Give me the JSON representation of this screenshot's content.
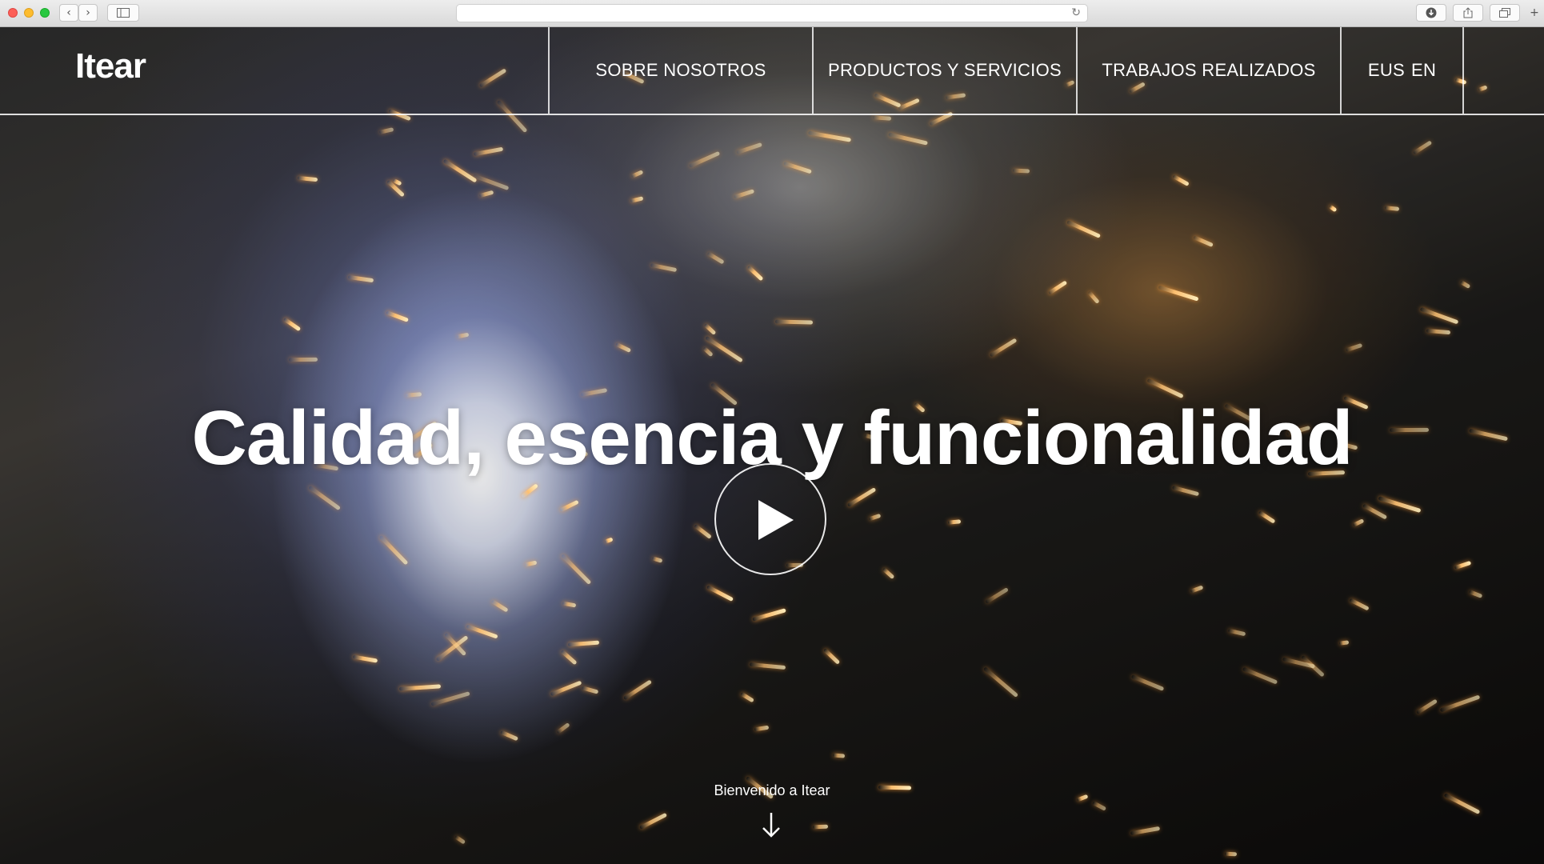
{
  "browser": {
    "back_icon": "chevron-left-icon",
    "forward_icon": "chevron-right-icon",
    "sidebar_icon": "sidebar-icon",
    "address_value": "",
    "reload_icon": "reload-icon",
    "download_icon": "download-icon",
    "share_icon": "share-icon",
    "tabs_icon": "tabs-icon",
    "new_tab_icon": "plus-icon"
  },
  "header": {
    "logo": "Itear",
    "nav": [
      {
        "label": "SOBRE NOSOTROS"
      },
      {
        "label": "PRODUCTOS Y SERVICIOS"
      },
      {
        "label": "TRABAJOS REALIZADOS"
      }
    ],
    "languages": [
      "EUS",
      "EN"
    ]
  },
  "hero": {
    "title": "Calidad, esencia y funcionalidad",
    "play_icon": "play-icon",
    "welcome": "Bienvenido a Itear",
    "scroll_icon": "arrow-down-icon"
  },
  "colors": {
    "chrome_background": "#e4e4e4",
    "text": "#ffffff",
    "spark": "#ffc070"
  }
}
